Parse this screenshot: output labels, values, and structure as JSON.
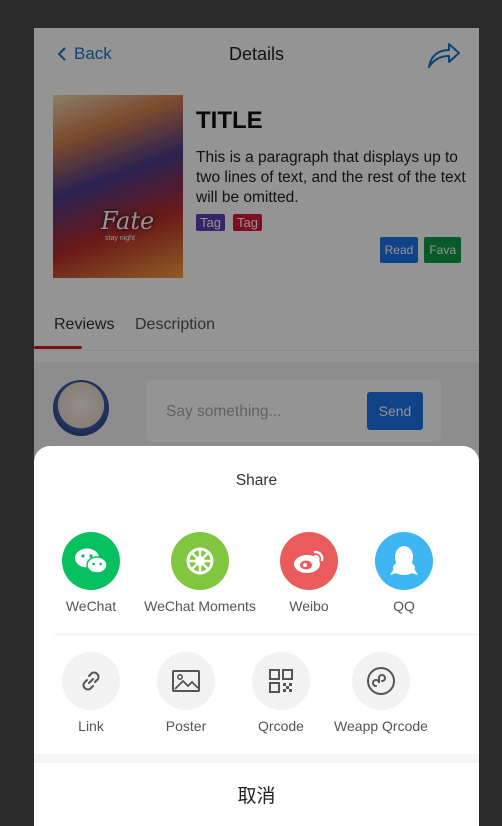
{
  "navbar": {
    "back_label": "Back",
    "title": "Details"
  },
  "book": {
    "title": "TITLE",
    "description": "This is a paragraph that displays up to two lines of text, and the rest of the text will be omitted.",
    "tags": [
      "Tag",
      "Tag"
    ],
    "actions": {
      "read": "Read",
      "fava": "Fava"
    }
  },
  "tabs": {
    "reviews": "Reviews",
    "description": "Description"
  },
  "comment": {
    "placeholder": "Say something...",
    "send_label": "Send"
  },
  "share_sheet": {
    "title": "Share",
    "social": [
      {
        "label": "WeChat",
        "icon": "wechat-icon",
        "color": "#07c160"
      },
      {
        "label": "WeChat Moments",
        "icon": "wechat-moments-icon",
        "color": "#80c63e"
      },
      {
        "label": "Weibo",
        "icon": "weibo-icon",
        "color": "#ea5c5c"
      },
      {
        "label": "QQ",
        "icon": "qq-icon",
        "color": "#3eb6f2"
      }
    ],
    "tools": [
      {
        "label": "Link",
        "icon": "link-icon"
      },
      {
        "label": "Poster",
        "icon": "image-icon"
      },
      {
        "label": "Qrcode",
        "icon": "qrcode-icon"
      },
      {
        "label": "Weapp Qrcode",
        "icon": "weapp-qrcode-icon"
      }
    ],
    "cancel_label": "取消"
  },
  "colors": {
    "accent": "#1a73e8",
    "tab_indicator": "#d31b1b"
  }
}
